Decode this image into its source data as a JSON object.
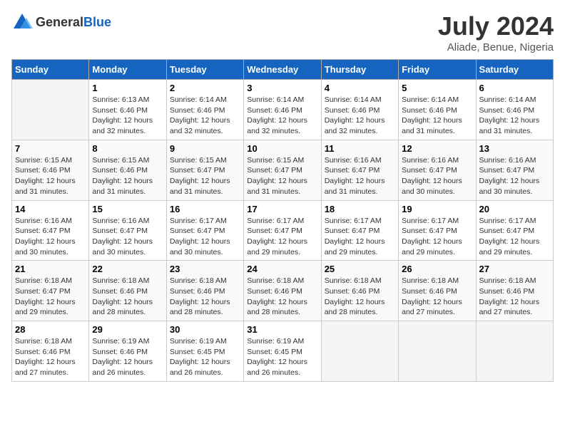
{
  "header": {
    "logo_general": "General",
    "logo_blue": "Blue",
    "month": "July 2024",
    "location": "Aliade, Benue, Nigeria"
  },
  "weekdays": [
    "Sunday",
    "Monday",
    "Tuesday",
    "Wednesday",
    "Thursday",
    "Friday",
    "Saturday"
  ],
  "weeks": [
    [
      {
        "day": "",
        "sunrise": "",
        "sunset": "",
        "daylight": ""
      },
      {
        "day": "1",
        "sunrise": "Sunrise: 6:13 AM",
        "sunset": "Sunset: 6:46 PM",
        "daylight": "Daylight: 12 hours and 32 minutes."
      },
      {
        "day": "2",
        "sunrise": "Sunrise: 6:14 AM",
        "sunset": "Sunset: 6:46 PM",
        "daylight": "Daylight: 12 hours and 32 minutes."
      },
      {
        "day": "3",
        "sunrise": "Sunrise: 6:14 AM",
        "sunset": "Sunset: 6:46 PM",
        "daylight": "Daylight: 12 hours and 32 minutes."
      },
      {
        "day": "4",
        "sunrise": "Sunrise: 6:14 AM",
        "sunset": "Sunset: 6:46 PM",
        "daylight": "Daylight: 12 hours and 32 minutes."
      },
      {
        "day": "5",
        "sunrise": "Sunrise: 6:14 AM",
        "sunset": "Sunset: 6:46 PM",
        "daylight": "Daylight: 12 hours and 31 minutes."
      },
      {
        "day": "6",
        "sunrise": "Sunrise: 6:14 AM",
        "sunset": "Sunset: 6:46 PM",
        "daylight": "Daylight: 12 hours and 31 minutes."
      }
    ],
    [
      {
        "day": "7",
        "sunrise": "Sunrise: 6:15 AM",
        "sunset": "Sunset: 6:46 PM",
        "daylight": "Daylight: 12 hours and 31 minutes."
      },
      {
        "day": "8",
        "sunrise": "Sunrise: 6:15 AM",
        "sunset": "Sunset: 6:46 PM",
        "daylight": "Daylight: 12 hours and 31 minutes."
      },
      {
        "day": "9",
        "sunrise": "Sunrise: 6:15 AM",
        "sunset": "Sunset: 6:47 PM",
        "daylight": "Daylight: 12 hours and 31 minutes."
      },
      {
        "day": "10",
        "sunrise": "Sunrise: 6:15 AM",
        "sunset": "Sunset: 6:47 PM",
        "daylight": "Daylight: 12 hours and 31 minutes."
      },
      {
        "day": "11",
        "sunrise": "Sunrise: 6:16 AM",
        "sunset": "Sunset: 6:47 PM",
        "daylight": "Daylight: 12 hours and 31 minutes."
      },
      {
        "day": "12",
        "sunrise": "Sunrise: 6:16 AM",
        "sunset": "Sunset: 6:47 PM",
        "daylight": "Daylight: 12 hours and 30 minutes."
      },
      {
        "day": "13",
        "sunrise": "Sunrise: 6:16 AM",
        "sunset": "Sunset: 6:47 PM",
        "daylight": "Daylight: 12 hours and 30 minutes."
      }
    ],
    [
      {
        "day": "14",
        "sunrise": "Sunrise: 6:16 AM",
        "sunset": "Sunset: 6:47 PM",
        "daylight": "Daylight: 12 hours and 30 minutes."
      },
      {
        "day": "15",
        "sunrise": "Sunrise: 6:16 AM",
        "sunset": "Sunset: 6:47 PM",
        "daylight": "Daylight: 12 hours and 30 minutes."
      },
      {
        "day": "16",
        "sunrise": "Sunrise: 6:17 AM",
        "sunset": "Sunset: 6:47 PM",
        "daylight": "Daylight: 12 hours and 30 minutes."
      },
      {
        "day": "17",
        "sunrise": "Sunrise: 6:17 AM",
        "sunset": "Sunset: 6:47 PM",
        "daylight": "Daylight: 12 hours and 29 minutes."
      },
      {
        "day": "18",
        "sunrise": "Sunrise: 6:17 AM",
        "sunset": "Sunset: 6:47 PM",
        "daylight": "Daylight: 12 hours and 29 minutes."
      },
      {
        "day": "19",
        "sunrise": "Sunrise: 6:17 AM",
        "sunset": "Sunset: 6:47 PM",
        "daylight": "Daylight: 12 hours and 29 minutes."
      },
      {
        "day": "20",
        "sunrise": "Sunrise: 6:17 AM",
        "sunset": "Sunset: 6:47 PM",
        "daylight": "Daylight: 12 hours and 29 minutes."
      }
    ],
    [
      {
        "day": "21",
        "sunrise": "Sunrise: 6:18 AM",
        "sunset": "Sunset: 6:47 PM",
        "daylight": "Daylight: 12 hours and 29 minutes."
      },
      {
        "day": "22",
        "sunrise": "Sunrise: 6:18 AM",
        "sunset": "Sunset: 6:46 PM",
        "daylight": "Daylight: 12 hours and 28 minutes."
      },
      {
        "day": "23",
        "sunrise": "Sunrise: 6:18 AM",
        "sunset": "Sunset: 6:46 PM",
        "daylight": "Daylight: 12 hours and 28 minutes."
      },
      {
        "day": "24",
        "sunrise": "Sunrise: 6:18 AM",
        "sunset": "Sunset: 6:46 PM",
        "daylight": "Daylight: 12 hours and 28 minutes."
      },
      {
        "day": "25",
        "sunrise": "Sunrise: 6:18 AM",
        "sunset": "Sunset: 6:46 PM",
        "daylight": "Daylight: 12 hours and 28 minutes."
      },
      {
        "day": "26",
        "sunrise": "Sunrise: 6:18 AM",
        "sunset": "Sunset: 6:46 PM",
        "daylight": "Daylight: 12 hours and 27 minutes."
      },
      {
        "day": "27",
        "sunrise": "Sunrise: 6:18 AM",
        "sunset": "Sunset: 6:46 PM",
        "daylight": "Daylight: 12 hours and 27 minutes."
      }
    ],
    [
      {
        "day": "28",
        "sunrise": "Sunrise: 6:18 AM",
        "sunset": "Sunset: 6:46 PM",
        "daylight": "Daylight: 12 hours and 27 minutes."
      },
      {
        "day": "29",
        "sunrise": "Sunrise: 6:19 AM",
        "sunset": "Sunset: 6:46 PM",
        "daylight": "Daylight: 12 hours and 26 minutes."
      },
      {
        "day": "30",
        "sunrise": "Sunrise: 6:19 AM",
        "sunset": "Sunset: 6:45 PM",
        "daylight": "Daylight: 12 hours and 26 minutes."
      },
      {
        "day": "31",
        "sunrise": "Sunrise: 6:19 AM",
        "sunset": "Sunset: 6:45 PM",
        "daylight": "Daylight: 12 hours and 26 minutes."
      },
      {
        "day": "",
        "sunrise": "",
        "sunset": "",
        "daylight": ""
      },
      {
        "day": "",
        "sunrise": "",
        "sunset": "",
        "daylight": ""
      },
      {
        "day": "",
        "sunrise": "",
        "sunset": "",
        "daylight": ""
      }
    ]
  ]
}
